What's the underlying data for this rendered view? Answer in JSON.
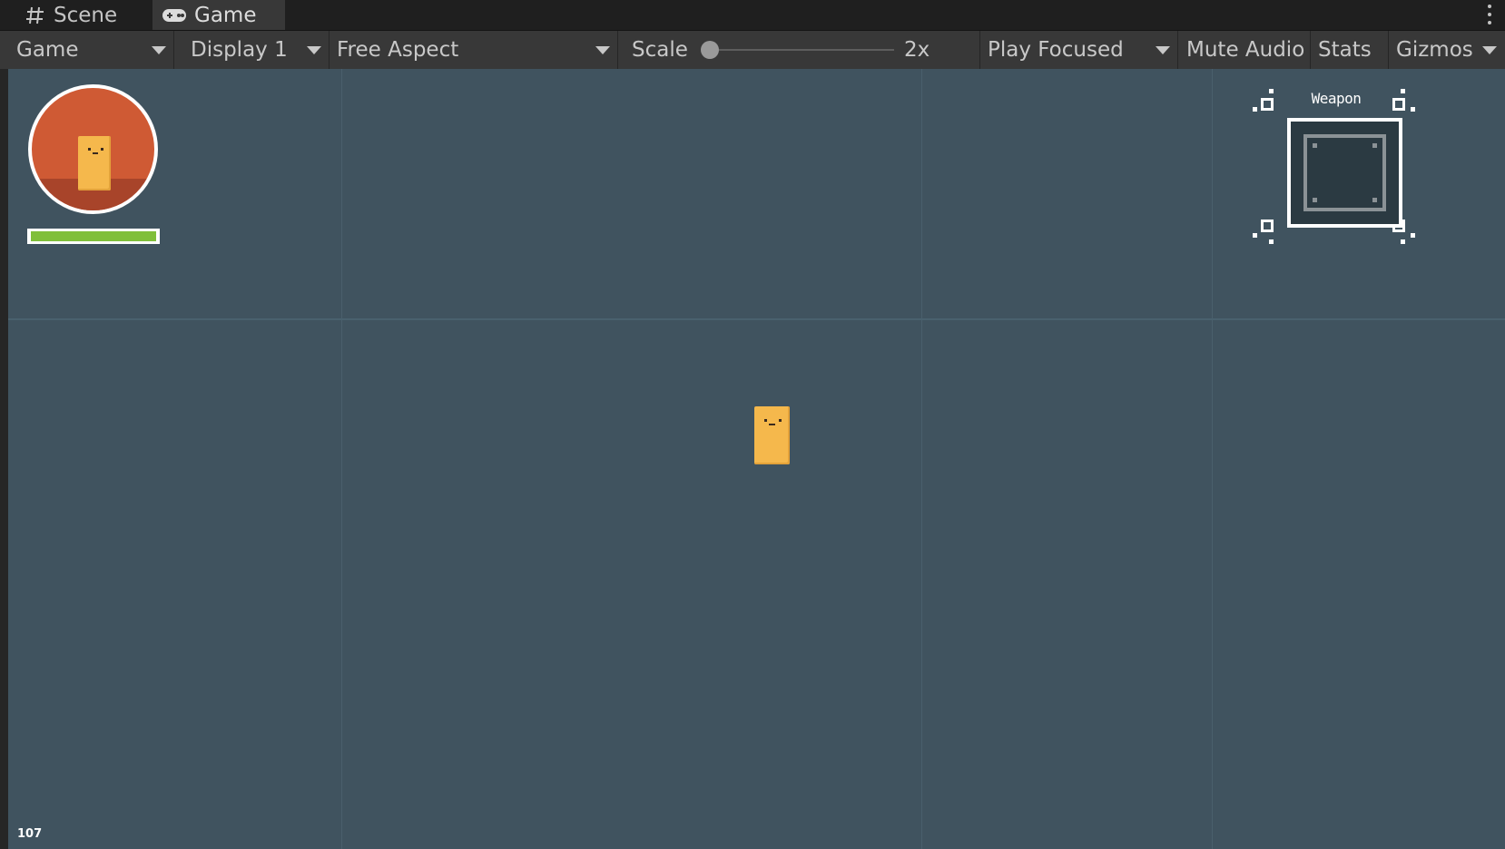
{
  "tabs": [
    {
      "label": "Scene",
      "icon": "hash-icon",
      "active": false
    },
    {
      "label": "Game",
      "icon": "gamepad-icon",
      "active": true
    }
  ],
  "toolbar": {
    "view_mode": "Game",
    "display": "Display 1",
    "aspect": "Free Aspect",
    "scale_label": "Scale",
    "scale_value": "2x",
    "play_mode": "Play Focused",
    "mute_audio": "Mute Audio",
    "stats": "Stats",
    "gizmos": "Gizmos"
  },
  "hud": {
    "health_fraction": 1.0,
    "weapon_label": "Weapon",
    "counter": "107"
  },
  "colors": {
    "background": "#40535f",
    "portrait": "#cf5a34",
    "health": "#80bf3a",
    "character": "#f5b84c"
  }
}
